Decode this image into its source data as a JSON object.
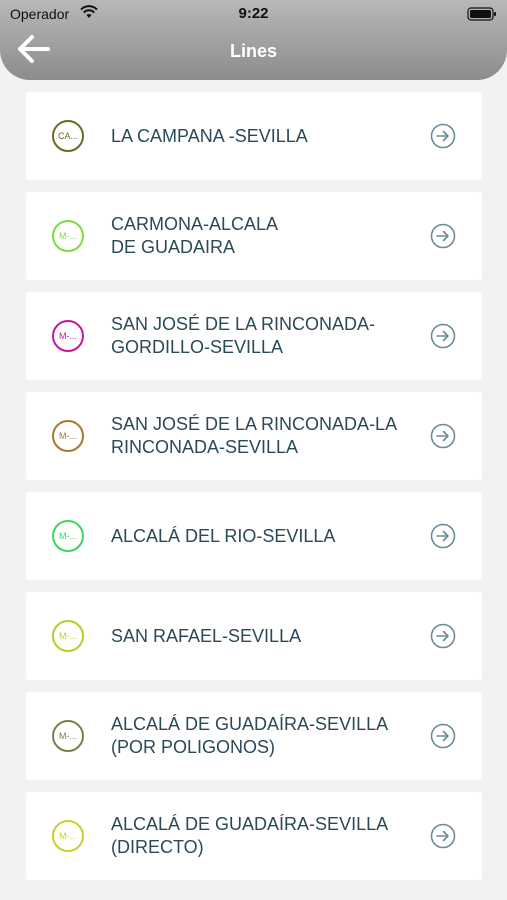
{
  "status_bar": {
    "carrier": "Operador",
    "time": "9:22"
  },
  "header": {
    "title": "Lines",
    "back_icon": "arrow-left-icon"
  },
  "colors": {
    "header_bg": "#8c8c8c",
    "text": "#2a4a58",
    "arrow": "#6a8a96"
  },
  "lines": [
    {
      "badge": "CA...",
      "name": "LA CAMPANA -SEVILLA",
      "color": "#6b6b1f"
    },
    {
      "badge": "M-...",
      "name": "CARMONA-ALCALA\nDE GUADAIRA",
      "color": "#7ddc3e"
    },
    {
      "badge": "M-...",
      "name": "SAN JOSÉ DE LA RINCONADA-\nGORDILLO-SEVILLA",
      "color": "#c4179e"
    },
    {
      "badge": "M-...",
      "name": "SAN JOSÉ DE LA RINCONADA-LA\nRINCONADA-SEVILLA",
      "color": "#a8792a"
    },
    {
      "badge": "M-...",
      "name": "ALCALÁ DEL RIO-SEVILLA",
      "color": "#3fd35f"
    },
    {
      "badge": "M-...",
      "name": "SAN RAFAEL-SEVILLA",
      "color": "#b4d12a"
    },
    {
      "badge": "M-...",
      "name": "ALCALÁ DE GUADAÍRA-SEVILLA\n(POR POLIGONOS)",
      "color": "#7d7d4a"
    },
    {
      "badge": "M-...",
      "name": "ALCALÁ DE GUADAÍRA-SEVILLA\n(DIRECTO)",
      "color": "#d2cc2a"
    }
  ]
}
